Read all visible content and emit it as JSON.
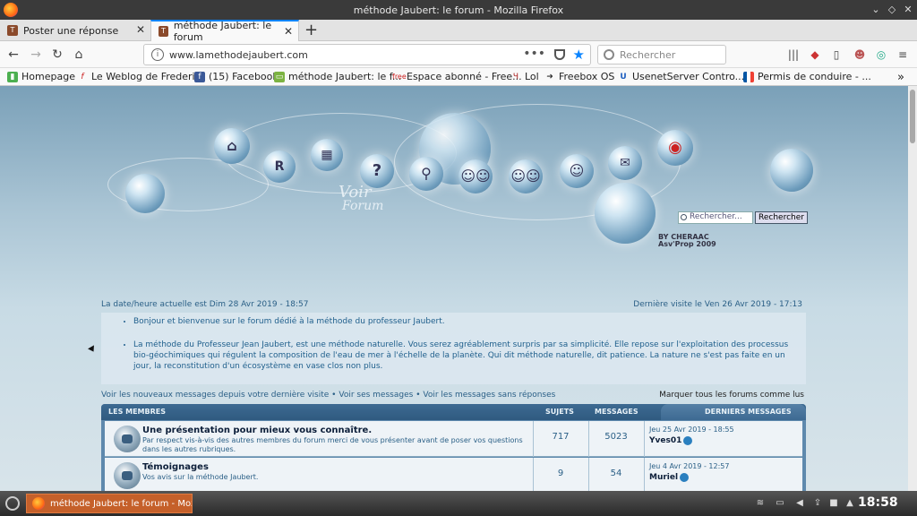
{
  "window": {
    "title": "méthode Jaubert: le forum - Mozilla Firefox"
  },
  "tabs": [
    {
      "label": "Poster une réponse"
    },
    {
      "label": "méthode Jaubert: le forum"
    }
  ],
  "navbar": {
    "url": "www.lamethodejaubert.com",
    "search_placeholder": "Rechercher"
  },
  "bookmarks": [
    {
      "label": "Homepage"
    },
    {
      "label": "Le Weblog de Frederi..."
    },
    {
      "label": "(15) Facebook"
    },
    {
      "label": "méthode Jaubert: le f..."
    },
    {
      "label": "Espace abonné - Free..."
    },
    {
      "label": "Lol"
    },
    {
      "label": "Freebox OS"
    },
    {
      "label": "UsenetServer Contro..."
    },
    {
      "label": "Permis de conduire - ..."
    }
  ],
  "forum": {
    "search_placeholder": "Rechercher...",
    "search_button": "Rechercher",
    "logo_line1": "Voir",
    "logo_line2": "Forum",
    "credit1": "BY CHERAAC",
    "credit2": "Asv'Prop 2009",
    "date_current": "La date/heure actuelle est Dim 28 Avr 2019 - 18:57",
    "last_visit": "Dernière visite le Ven 26 Avr 2019 - 17:13",
    "welcome": [
      "Bonjour et bienvenue sur le forum dédié à la méthode du professeur Jaubert.",
      "La méthode du Professeur Jean Jaubert, est une méthode naturelle. Vous serez agréablement surpris par sa simplicité. Elle repose sur l'exploitation des processus bio-géochimiques qui régulent la composition de l'eau de mer à l'échelle de la planète. Qui dit méthode naturelle, dit patience. La nature ne s'est pas faite en un jour, la reconstitution d'un écosystème en vase clos non plus."
    ],
    "links": {
      "new_messages": "Voir les nouveaux messages depuis votre dernière visite",
      "own_messages": "Voir ses messages",
      "unanswered": "Voir les messages sans réponses",
      "separator": "•",
      "mark_all": "Marquer tous les forums comme lus"
    },
    "table_headers": {
      "category": "LES MEMBRES",
      "topics": "SUJETS",
      "messages": "MESSAGES",
      "last": "DERNIERS MESSAGES"
    },
    "rows": [
      {
        "title": "Une présentation pour mieux vous connaître.",
        "desc": "Par respect vis-à-vis des autres membres du forum merci de vous présenter avant de poser vos questions dans les autres rubriques.",
        "topics": "717",
        "messages": "5023",
        "last_date": "Jeu 25 Avr 2019 - 18:55",
        "last_author": "Yves01"
      },
      {
        "title": "Témoignages",
        "desc": "Vos avis sur la méthode Jaubert.",
        "topics": "9",
        "messages": "54",
        "last_date": "Jeu 4 Avr 2019 - 12:57",
        "last_author": "Muriel"
      }
    ]
  },
  "taskbar": {
    "window_button": "méthode Jaubert: le forum - Mozil...",
    "clock": "18:58"
  }
}
